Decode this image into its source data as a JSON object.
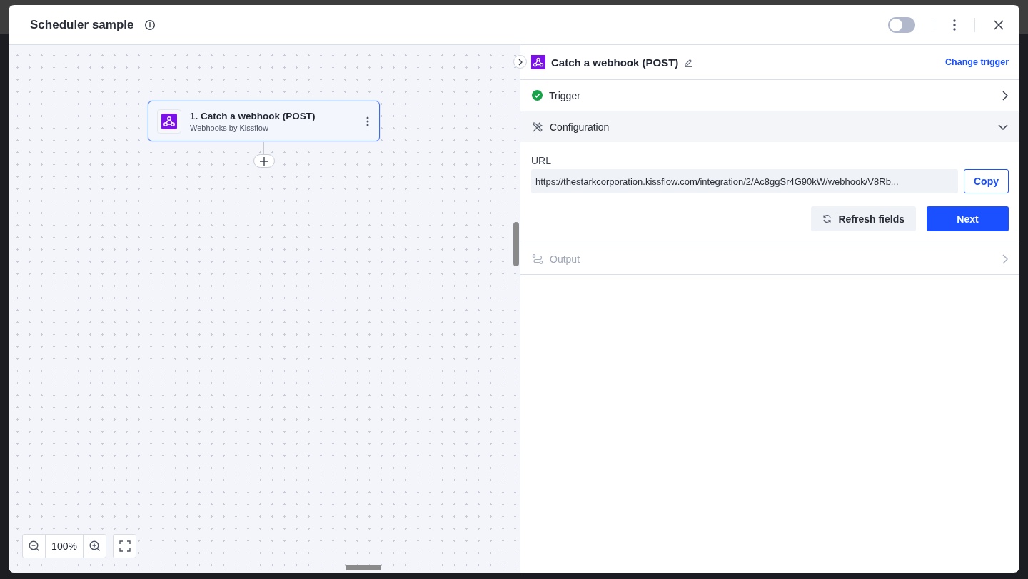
{
  "window": {
    "title": "Scheduler sample",
    "toggle": {
      "on": false
    }
  },
  "canvas": {
    "node": {
      "title": "1. Catch a webhook (POST)",
      "subtitle": "Webhooks by Kissflow",
      "selected": true
    },
    "zoom": {
      "value": "100%"
    }
  },
  "panel": {
    "title": "Catch a webhook (POST)",
    "action": "Change trigger",
    "sections": [
      {
        "kind": "trigger",
        "label": "Trigger",
        "expanded": false,
        "disabled": false,
        "done": true
      },
      {
        "kind": "configuration",
        "label": "Configuration",
        "expanded": true,
        "disabled": false
      },
      {
        "kind": "output",
        "label": "Output",
        "expanded": false,
        "disabled": true
      }
    ],
    "url": {
      "label": "URL",
      "value": "https://thestarkcorporation.kissflow.com/integration/2/Ac8ggSr4G90kW/webhook/V8Rb...",
      "copy": "Copy"
    },
    "buttons": {
      "refresh": "Refresh fields",
      "next": "Next"
    }
  }
}
